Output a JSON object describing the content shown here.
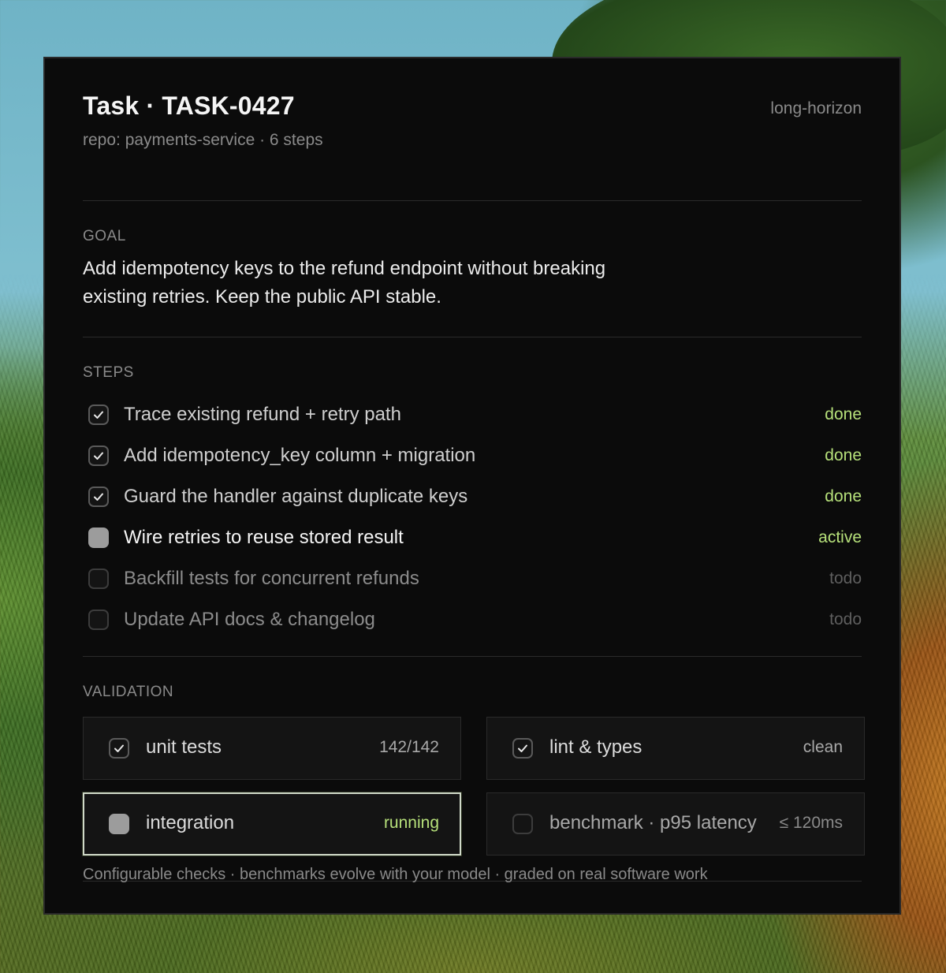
{
  "task": {
    "title": "Task · TASK-0427",
    "subtitle": "repo: payments-service · 6 steps",
    "tag": "long-horizon"
  },
  "goal": {
    "label": "GOAL",
    "text": "Add idempotency keys to the refund endpoint without breaking existing retries. Keep the public API stable."
  },
  "steps": {
    "label": "STEPS",
    "items": [
      {
        "label": "Trace existing refund + retry path",
        "status": "done",
        "state": "checked"
      },
      {
        "label": "Add idempotency_key column + migration",
        "status": "done",
        "state": "checked"
      },
      {
        "label": "Guard the handler against duplicate keys",
        "status": "done",
        "state": "checked"
      },
      {
        "label": "Wire retries to reuse stored result",
        "status": "active",
        "state": "active"
      },
      {
        "label": "Backfill tests for concurrent refunds",
        "status": "todo",
        "state": "empty"
      },
      {
        "label": "Update API docs & changelog",
        "status": "todo",
        "state": "empty"
      }
    ]
  },
  "validation": {
    "label": "VALIDATION",
    "checks": [
      {
        "label": "unit tests",
        "value": "142/142",
        "state": "checked"
      },
      {
        "label": "lint & types",
        "value": "clean",
        "state": "checked"
      },
      {
        "label": "integration",
        "value": "running",
        "state": "active"
      },
      {
        "label": "benchmark · p95 latency",
        "value": "≤ 120ms",
        "state": "empty"
      }
    ]
  },
  "footer": {
    "text": "Configurable checks · benchmarks evolve with your model · graded on real software work"
  },
  "colors": {
    "accent_green": "#b6e07a",
    "panel_bg": "#0b0b0b",
    "muted_text": "#8a8a8a"
  }
}
